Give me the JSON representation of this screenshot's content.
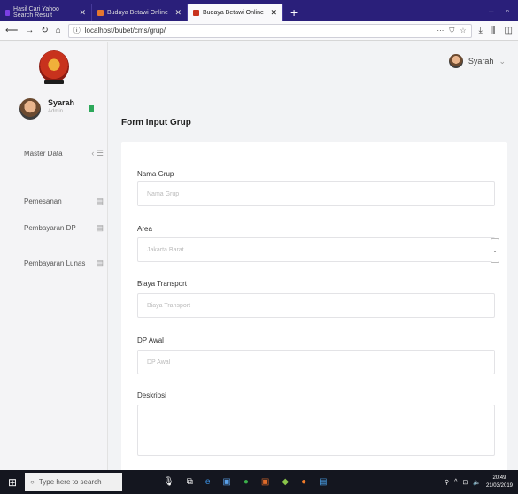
{
  "browser": {
    "tabs": [
      {
        "label": "Hasil Cari Yahoo Search Result",
        "fav_color": "#7b3fe4"
      },
      {
        "label": "Budaya Betawi Online",
        "fav_color": "#e5772e"
      },
      {
        "label": "Budaya Betawi Online",
        "fav_color": "#c8321d"
      }
    ],
    "url": "localhost/bubet/cms/grup/"
  },
  "sidebar": {
    "user_name": "Syarah",
    "user_role": "Admin",
    "menu": [
      {
        "label": "Master Data",
        "icon": "‹ ☰"
      },
      {
        "label": "Pemesanan",
        "icon": "▤"
      },
      {
        "label": "Pembayaran DP",
        "icon": "▤"
      },
      {
        "label": "Pembayaran Lunas",
        "icon": "▤"
      }
    ]
  },
  "header": {
    "user_name": "Syarah"
  },
  "page": {
    "title": "Form Input Grup"
  },
  "form": {
    "nama_grup": {
      "label": "Nama Grup",
      "placeholder": "Nama Grup"
    },
    "area": {
      "label": "Area",
      "value": "Jakarta Barat"
    },
    "biaya_transport": {
      "label": "Biaya Transport",
      "placeholder": "Biaya Transport"
    },
    "dp_awal": {
      "label": "DP Awal",
      "placeholder": "DP Awal"
    },
    "deskripsi": {
      "label": "Deskripsi",
      "placeholder": ""
    }
  },
  "taskbar": {
    "search_placeholder": "Type here to search",
    "time": "20:49",
    "date": "21/03/2019"
  }
}
